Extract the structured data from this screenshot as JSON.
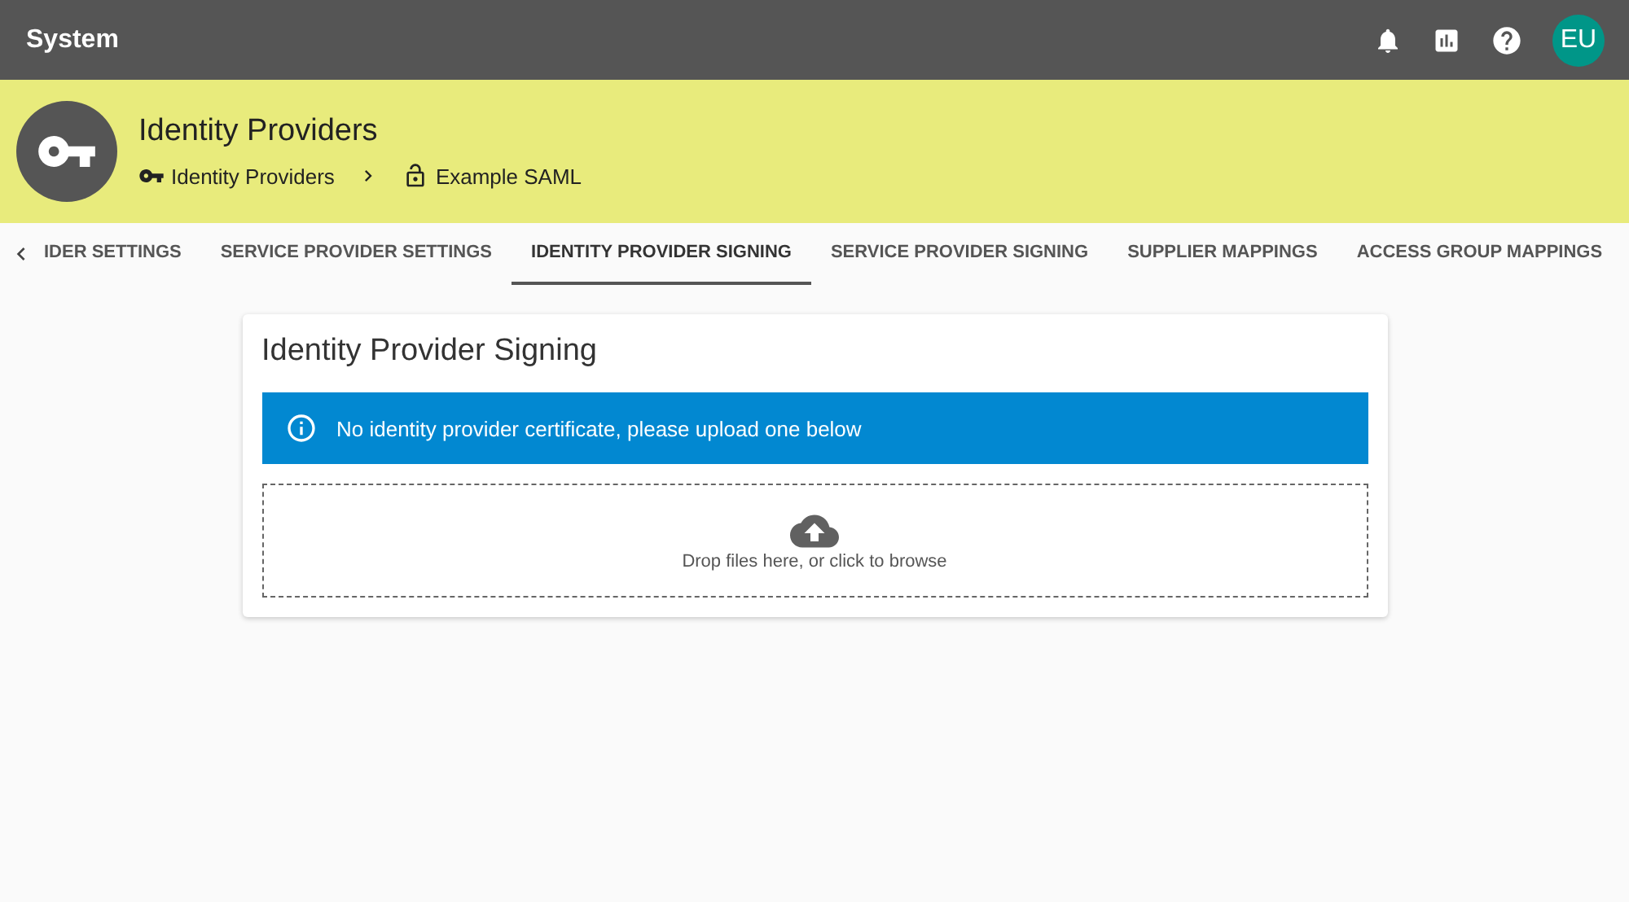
{
  "app_bar": {
    "title": "System",
    "avatar": "EU"
  },
  "header": {
    "title": "Identity Providers",
    "breadcrumb": [
      "Identity Providers",
      "Example SAML"
    ]
  },
  "tabs": [
    {
      "label": "IDER SETTINGS",
      "selected": false
    },
    {
      "label": "SERVICE PROVIDER SETTINGS",
      "selected": false
    },
    {
      "label": "IDENTITY PROVIDER SIGNING",
      "selected": true
    },
    {
      "label": "SERVICE PROVIDER SIGNING",
      "selected": false
    },
    {
      "label": "SUPPLIER MAPPINGS",
      "selected": false
    },
    {
      "label": "ACCESS GROUP MAPPINGS",
      "selected": false
    }
  ],
  "card": {
    "title": "Identity Provider Signing",
    "alert": "No identity provider certificate, please upload one below",
    "dropzone": "Drop files here, or click to browse"
  }
}
